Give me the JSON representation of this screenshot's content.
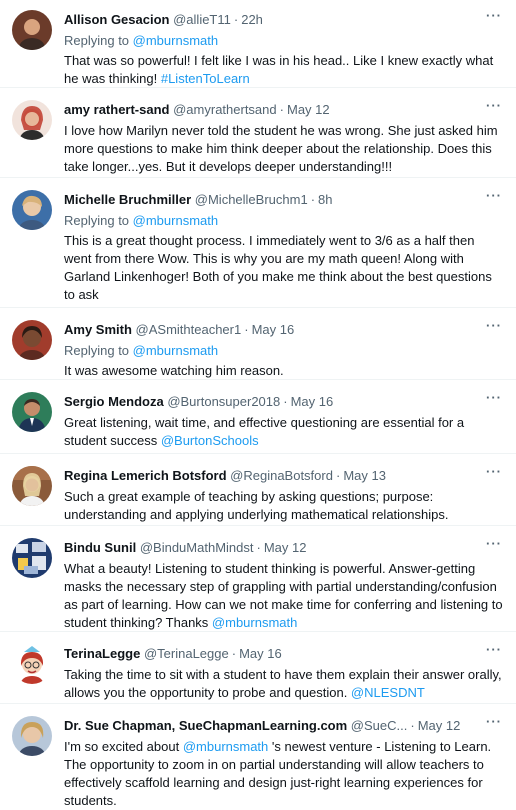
{
  "tweets": [
    {
      "name": "Allison Gesacion",
      "handle": "@allieT11",
      "time": "22h",
      "replying_prefix": "Replying to ",
      "replying_to": "@mburnsmath",
      "text": "That was so powerful! I felt like I was in his head.. Like I knew exactly what he was thinking! ",
      "link": "#ListenToLearn",
      "avatar_colors": [
        "#6b3b2a",
        "#d9a47f"
      ]
    },
    {
      "name": "amy rathert-sand",
      "handle": "@amyrathertsand",
      "time": "May 12",
      "text": "I love how Marilyn never told the student he was wrong. She just asked him more questions to make him think deeper about the relationship. Does this take longer...yes. But it develops deeper understanding!!!",
      "avatar_colors": [
        "#c0392b",
        "#e7b79a"
      ]
    },
    {
      "name": "Michelle Bruchmiller",
      "handle": "@MichelleBruchm1",
      "time": "8h",
      "replying_prefix": "Replying to ",
      "replying_to": "@mburnsmath",
      "text": "This is a great thought process. I immediately went to 3/6 as a half then went from there   Wow. This is why you are my math queen!  Along with Garland Linkenhoger!  Both of you make me think about the best questions to ask",
      "avatar_colors": [
        "#3d6fa8",
        "#e9c9a8"
      ]
    },
    {
      "name": "Amy Smith",
      "handle": "@ASmithteacher1",
      "time": "May 16",
      "replying_prefix": "Replying to ",
      "replying_to": "@mburnsmath",
      "text": "It was awesome watching him reason.",
      "avatar_colors": [
        "#2b1b14",
        "#7a4a32"
      ]
    },
    {
      "name": "Sergio Mendoza",
      "handle": "@Burtonsuper2018",
      "time": "May 16",
      "text": "Great listening, wait time, and effective questioning are essential for a student success ",
      "link": "@BurtonSchools",
      "avatar_colors": [
        "#2e7d5a",
        "#c58d6b"
      ]
    },
    {
      "name": "Regina Lemerich Botsford",
      "handle": "@ReginaBotsford",
      "time": "May 13",
      "text": "Such a great example of teaching by asking questions; purpose: understanding and applying underlying mathematical relationships.",
      "avatar_colors": [
        "#8a5a3a",
        "#e2c19c"
      ]
    },
    {
      "name": "Bindu Sunil",
      "handle": "@BinduMathMindst",
      "time": "May 12",
      "text": "What a beauty! Listening to student thinking is powerful. Answer-getting masks the necessary step of grappling with partial understanding/confusion as part of learning. How can we not make time for conferring and listening to student thinking? Thanks ",
      "link": "@mburnsmath",
      "avatar_colors": [
        "#1f3b6e",
        "#e0e6ef"
      ]
    },
    {
      "name": "TerinaLegge",
      "handle": "@TerinaLegge",
      "time": "May 16",
      "text": "Taking the time to sit with a student to have them explain their answer orally, allows you the opportunity to probe and question. ",
      "link": "@NLESDNT",
      "avatar_colors": [
        "#c0392b",
        "#f5d3b8"
      ]
    },
    {
      "name": "Dr. Sue Chapman, SueChapmanLearning.com",
      "handle": "@SueC...",
      "time": "May 12",
      "text_prefix": "I'm so excited about ",
      "mention": "@mburnsmath",
      "text": " 's newest venture - Listening to Learn. The opportunity to zoom in on partial understanding will allow teachers to effectively scaffold learning and design just-right learning experiences for students.",
      "avatar_colors": [
        "#c9a15a",
        "#e8c7a8"
      ]
    }
  ],
  "more_label": "···",
  "dot": "·",
  "link_color": "#1d9bf0"
}
